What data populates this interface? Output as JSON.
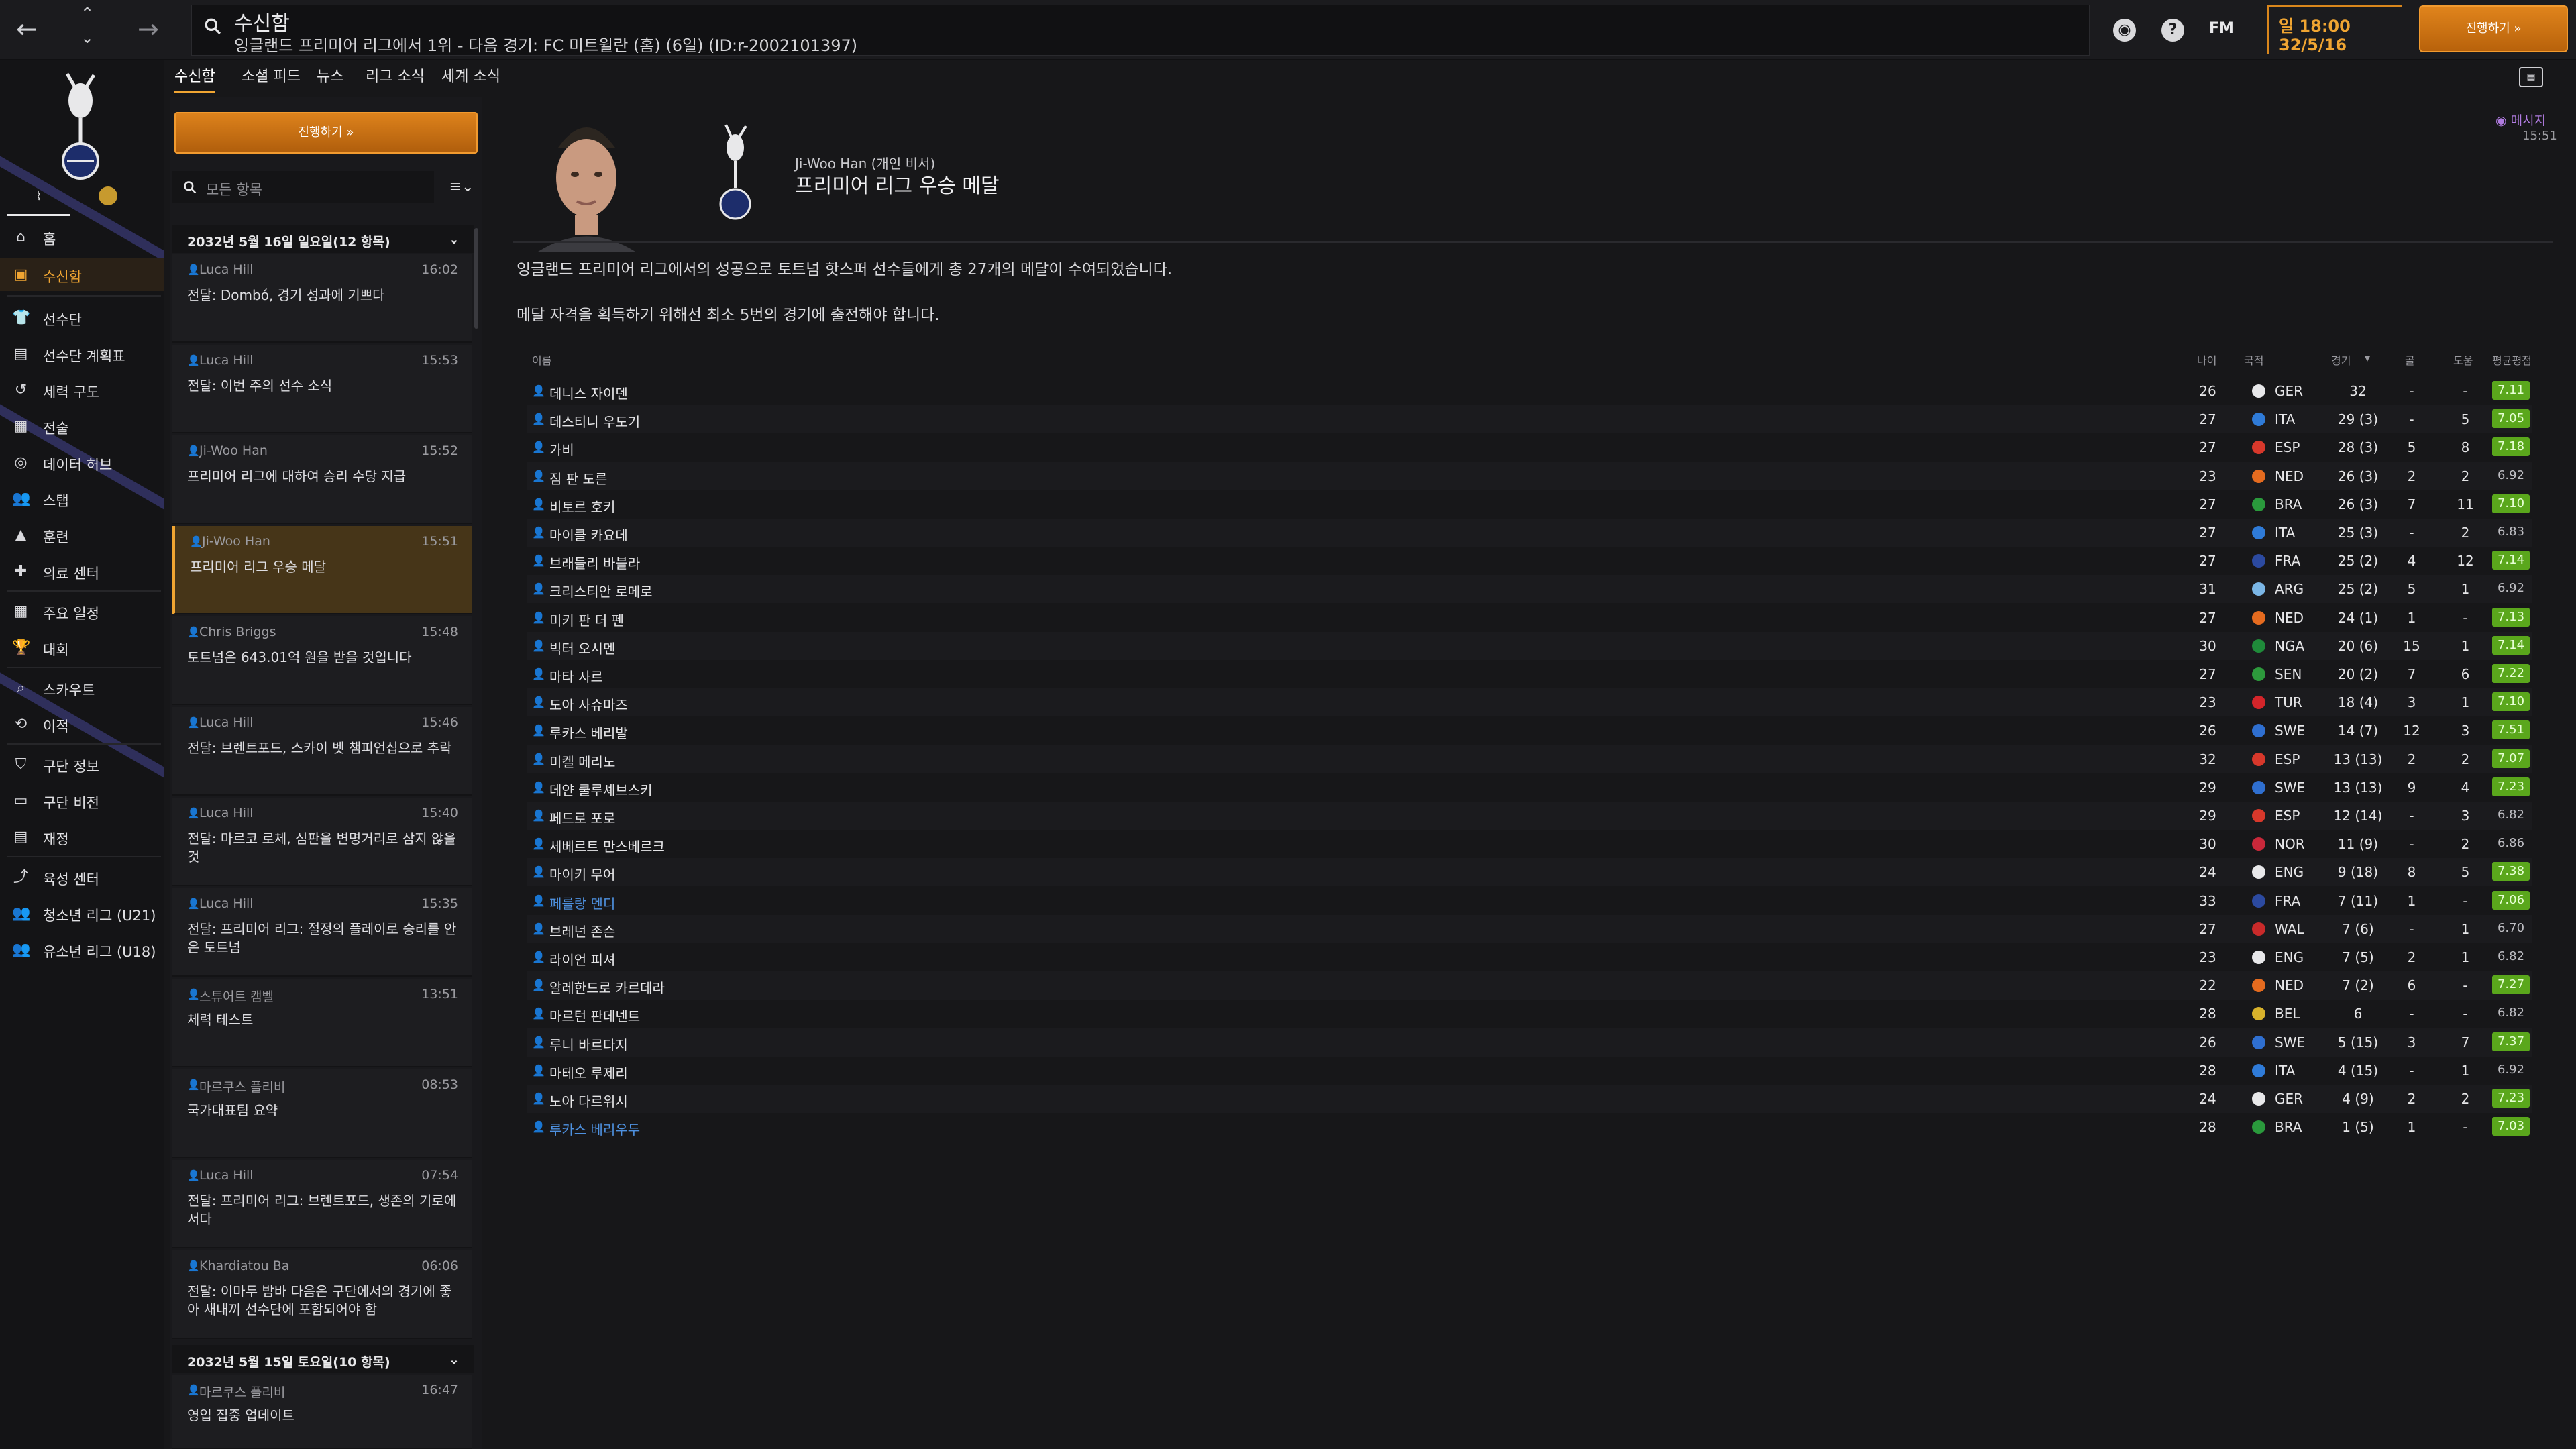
{
  "topbar": {
    "search_title": "수신함",
    "search_subtitle": "잉글랜드 프리미어 리그에서 1위 - 다음 경기: FC 미트윌란 (홈) (6일) (ID:r-2002101397)",
    "fm_label": "FM",
    "help_label": "?",
    "time_label": "일 18:00",
    "date_label": "32/5/16",
    "continue_label": "진행하기 »"
  },
  "sidebar": {
    "items": [
      {
        "label": "홈",
        "icon": "home-icon"
      },
      {
        "label": "수신함",
        "icon": "inbox-icon",
        "active": true
      },
      {
        "label": "선수단",
        "icon": "shirt-icon"
      },
      {
        "label": "선수단 계획표",
        "icon": "clipboard-icon"
      },
      {
        "label": "세력 구도",
        "icon": "dynamics-icon"
      },
      {
        "label": "전술",
        "icon": "tactics-icon"
      },
      {
        "label": "데이터 허브",
        "icon": "data-icon"
      },
      {
        "label": "스탭",
        "icon": "staff-icon"
      },
      {
        "label": "훈련",
        "icon": "training-icon"
      },
      {
        "label": "의료 센터",
        "icon": "medical-icon"
      },
      {
        "label": "주요 일정",
        "icon": "calendar-icon"
      },
      {
        "label": "대회",
        "icon": "trophy-icon"
      },
      {
        "label": "스카우트",
        "icon": "scouting-icon"
      },
      {
        "label": "이적",
        "icon": "transfer-icon"
      },
      {
        "label": "구단 정보",
        "icon": "shield-icon"
      },
      {
        "label": "구단 비전",
        "icon": "vision-icon"
      },
      {
        "label": "재정",
        "icon": "finance-icon"
      },
      {
        "label": "육성 센터",
        "icon": "development-icon"
      },
      {
        "label": "청소년 리그 (U21)",
        "icon": "u21-icon"
      },
      {
        "label": "유소년 리그 (U18)",
        "icon": "u18-icon"
      }
    ]
  },
  "tabs": [
    "수신함",
    "소셜 피드",
    "뉴스",
    "리그 소식",
    "세계 소식"
  ],
  "inbox": {
    "continue_label": "진행하기 »",
    "filter_placeholder": "모든 항목",
    "group1_header": "2032년 5월 16일 일요일(12 항목)",
    "group2_header": "2032년 5월 15일 토요일(10 항목)",
    "messages": [
      {
        "from": "Luca Hill",
        "time": "16:02",
        "subject": "전달: Dombó, 경기 성과에 기쁘다"
      },
      {
        "from": "Luca Hill",
        "time": "15:53",
        "subject": "전달: 이번 주의 선수 소식"
      },
      {
        "from": "Ji-Woo Han",
        "time": "15:52",
        "subject": "프리미어 리그에 대하여 승리 수당 지급"
      },
      {
        "from": "Ji-Woo Han",
        "time": "15:51",
        "subject": "프리미어 리그 우승 메달",
        "selected": true
      },
      {
        "from": "Chris Briggs",
        "time": "15:48",
        "subject": "토트넘은 643.01억 원을 받을 것입니다"
      },
      {
        "from": "Luca Hill",
        "time": "15:46",
        "subject": "전달: 브렌트포드, 스카이 벳 챔피언십으로 추락"
      },
      {
        "from": "Luca Hill",
        "time": "15:40",
        "subject": "전달: 마르코 로체, 심판을 변명거리로 삼지 않을 것"
      },
      {
        "from": "Luca Hill",
        "time": "15:35",
        "subject": "전달: 프리미어 리그: 절정의 플레이로 승리를 안은 토트넘"
      },
      {
        "from": "스튜어트 캠벨",
        "time": "13:51",
        "subject": "체력 테스트"
      },
      {
        "from": "마르쿠스 플리비",
        "time": "08:53",
        "subject": "국가대표팀 요약"
      },
      {
        "from": "Luca Hill",
        "time": "07:54",
        "subject": "전달: 프리미어 리그: 브렌트포드, 생존의 기로에 서다"
      },
      {
        "from": "Khardiatou Ba",
        "time": "06:06",
        "subject": "전달: 이마두 밤바 다음은 구단에서의 경기에 좋아 새내끼 선수단에 포함되어야 함"
      }
    ],
    "group2_first": {
      "from": "마르쿠스 플리비",
      "time": "16:47",
      "subject": "영입 집중 업데이트"
    }
  },
  "message": {
    "sender": "Ji-Woo Han (개인 비서)",
    "headline": "프리미어 리그 우승 메달",
    "tag": "메시지",
    "time": "15:51",
    "body1": "잉글랜드 프리미어 리그에서의 성공으로 토트넘 핫스퍼 선수들에게 총 27개의 메달이 수여되었습니다.",
    "body2": "메달 자격을 획득하기 위해선 최소 5번의 경기에 출전해야 합니다."
  },
  "table": {
    "headers": {
      "name": "이름",
      "age": "나이",
      "nat": "국적",
      "apps": "경기",
      "goals": "골",
      "assists": "도움",
      "rating": "평균평점"
    },
    "rows": [
      {
        "name": "데니스 자이덴",
        "age": "26",
        "nat": "GER",
        "apps": "32",
        "goals": "-",
        "assists": "-",
        "rating": "7.11",
        "good": true
      },
      {
        "name": "데스티니 우도기",
        "age": "27",
        "nat": "ITA",
        "apps": "29 (3)",
        "goals": "-",
        "assists": "5",
        "rating": "7.05",
        "good": true
      },
      {
        "name": "가비",
        "age": "27",
        "nat": "ESP",
        "apps": "28 (3)",
        "goals": "5",
        "assists": "8",
        "rating": "7.18",
        "good": true
      },
      {
        "name": "짐 판 도른",
        "age": "23",
        "nat": "NED",
        "apps": "26 (3)",
        "goals": "2",
        "assists": "2",
        "rating": "6.92",
        "good": false
      },
      {
        "name": "비토르 호키",
        "age": "27",
        "nat": "BRA",
        "apps": "26 (3)",
        "goals": "7",
        "assists": "11",
        "rating": "7.10",
        "good": true
      },
      {
        "name": "마이클 카요데",
        "age": "27",
        "nat": "ITA",
        "apps": "25 (3)",
        "goals": "-",
        "assists": "2",
        "rating": "6.83",
        "good": false
      },
      {
        "name": "브래들리 바블라",
        "age": "27",
        "nat": "FRA",
        "apps": "25 (2)",
        "goals": "4",
        "assists": "12",
        "rating": "7.14",
        "good": true
      },
      {
        "name": "크리스티안 로메로",
        "age": "31",
        "nat": "ARG",
        "apps": "25 (2)",
        "goals": "5",
        "assists": "1",
        "rating": "6.92",
        "good": false
      },
      {
        "name": "미키 판 더 펜",
        "age": "27",
        "nat": "NED",
        "apps": "24 (1)",
        "goals": "1",
        "assists": "-",
        "rating": "7.13",
        "good": true
      },
      {
        "name": "빅터 오시멘",
        "age": "30",
        "nat": "NGA",
        "apps": "20 (6)",
        "goals": "15",
        "assists": "1",
        "rating": "7.14",
        "good": true
      },
      {
        "name": "마타 사르",
        "age": "27",
        "nat": "SEN",
        "apps": "20 (2)",
        "goals": "7",
        "assists": "6",
        "rating": "7.22",
        "good": true
      },
      {
        "name": "도아 사슈마즈",
        "age": "23",
        "nat": "TUR",
        "apps": "18 (4)",
        "goals": "3",
        "assists": "1",
        "rating": "7.10",
        "good": true
      },
      {
        "name": "루카스 베리발",
        "age": "26",
        "nat": "SWE",
        "apps": "14 (7)",
        "goals": "12",
        "assists": "3",
        "rating": "7.51",
        "good": true
      },
      {
        "name": "미켈 메리노",
        "age": "32",
        "nat": "ESP",
        "apps": "13 (13)",
        "goals": "2",
        "assists": "2",
        "rating": "7.07",
        "good": true
      },
      {
        "name": "데얀 쿨루셰브스키",
        "age": "29",
        "nat": "SWE",
        "apps": "13 (13)",
        "goals": "9",
        "assists": "4",
        "rating": "7.23",
        "good": true
      },
      {
        "name": "페드로 포로",
        "age": "29",
        "nat": "ESP",
        "apps": "12 (14)",
        "goals": "-",
        "assists": "3",
        "rating": "6.82",
        "good": false
      },
      {
        "name": "세베르트 만스베르크",
        "age": "30",
        "nat": "NOR",
        "apps": "11 (9)",
        "goals": "-",
        "assists": "2",
        "rating": "6.86",
        "good": false
      },
      {
        "name": "마이키 무어",
        "age": "24",
        "nat": "ENG",
        "apps": "9 (18)",
        "goals": "8",
        "assists": "5",
        "rating": "7.38",
        "good": true
      },
      {
        "name": "페를랑 멘디",
        "age": "33",
        "nat": "FRA",
        "apps": "7 (11)",
        "goals": "1",
        "assists": "-",
        "rating": "7.06",
        "good": true,
        "highlight": true
      },
      {
        "name": "브레넌 존슨",
        "age": "27",
        "nat": "WAL",
        "apps": "7 (6)",
        "goals": "-",
        "assists": "1",
        "rating": "6.70",
        "good": false
      },
      {
        "name": "라이언 피셔",
        "age": "23",
        "nat": "ENG",
        "apps": "7 (5)",
        "goals": "2",
        "assists": "1",
        "rating": "6.82",
        "good": false
      },
      {
        "name": "알레한드로 카르데라",
        "age": "22",
        "nat": "NED",
        "apps": "7 (2)",
        "goals": "6",
        "assists": "-",
        "rating": "7.27",
        "good": true
      },
      {
        "name": "마르턴 판데넨트",
        "age": "28",
        "nat": "BEL",
        "apps": "6",
        "goals": "-",
        "assists": "-",
        "rating": "6.82",
        "good": false
      },
      {
        "name": "루니 바르다지",
        "age": "26",
        "nat": "SWE",
        "apps": "5 (15)",
        "goals": "3",
        "assists": "7",
        "rating": "7.37",
        "good": true
      },
      {
        "name": "마테오 루제리",
        "age": "28",
        "nat": "ITA",
        "apps": "4 (15)",
        "goals": "-",
        "assists": "1",
        "rating": "6.92",
        "good": false
      },
      {
        "name": "노아 다르위시",
        "age": "24",
        "nat": "GER",
        "apps": "4 (9)",
        "goals": "2",
        "assists": "2",
        "rating": "7.23",
        "good": true
      },
      {
        "name": "루카스 베리우두",
        "age": "28",
        "nat": "BRA",
        "apps": "1 (5)",
        "goals": "1",
        "assists": "-",
        "rating": "7.03",
        "good": true,
        "highlight": true
      }
    ]
  },
  "colors": {
    "accent": "#f0a532",
    "good_rating": "#5aa71c",
    "highlight_name": "#4e91e0",
    "selected_message": "#463518"
  }
}
